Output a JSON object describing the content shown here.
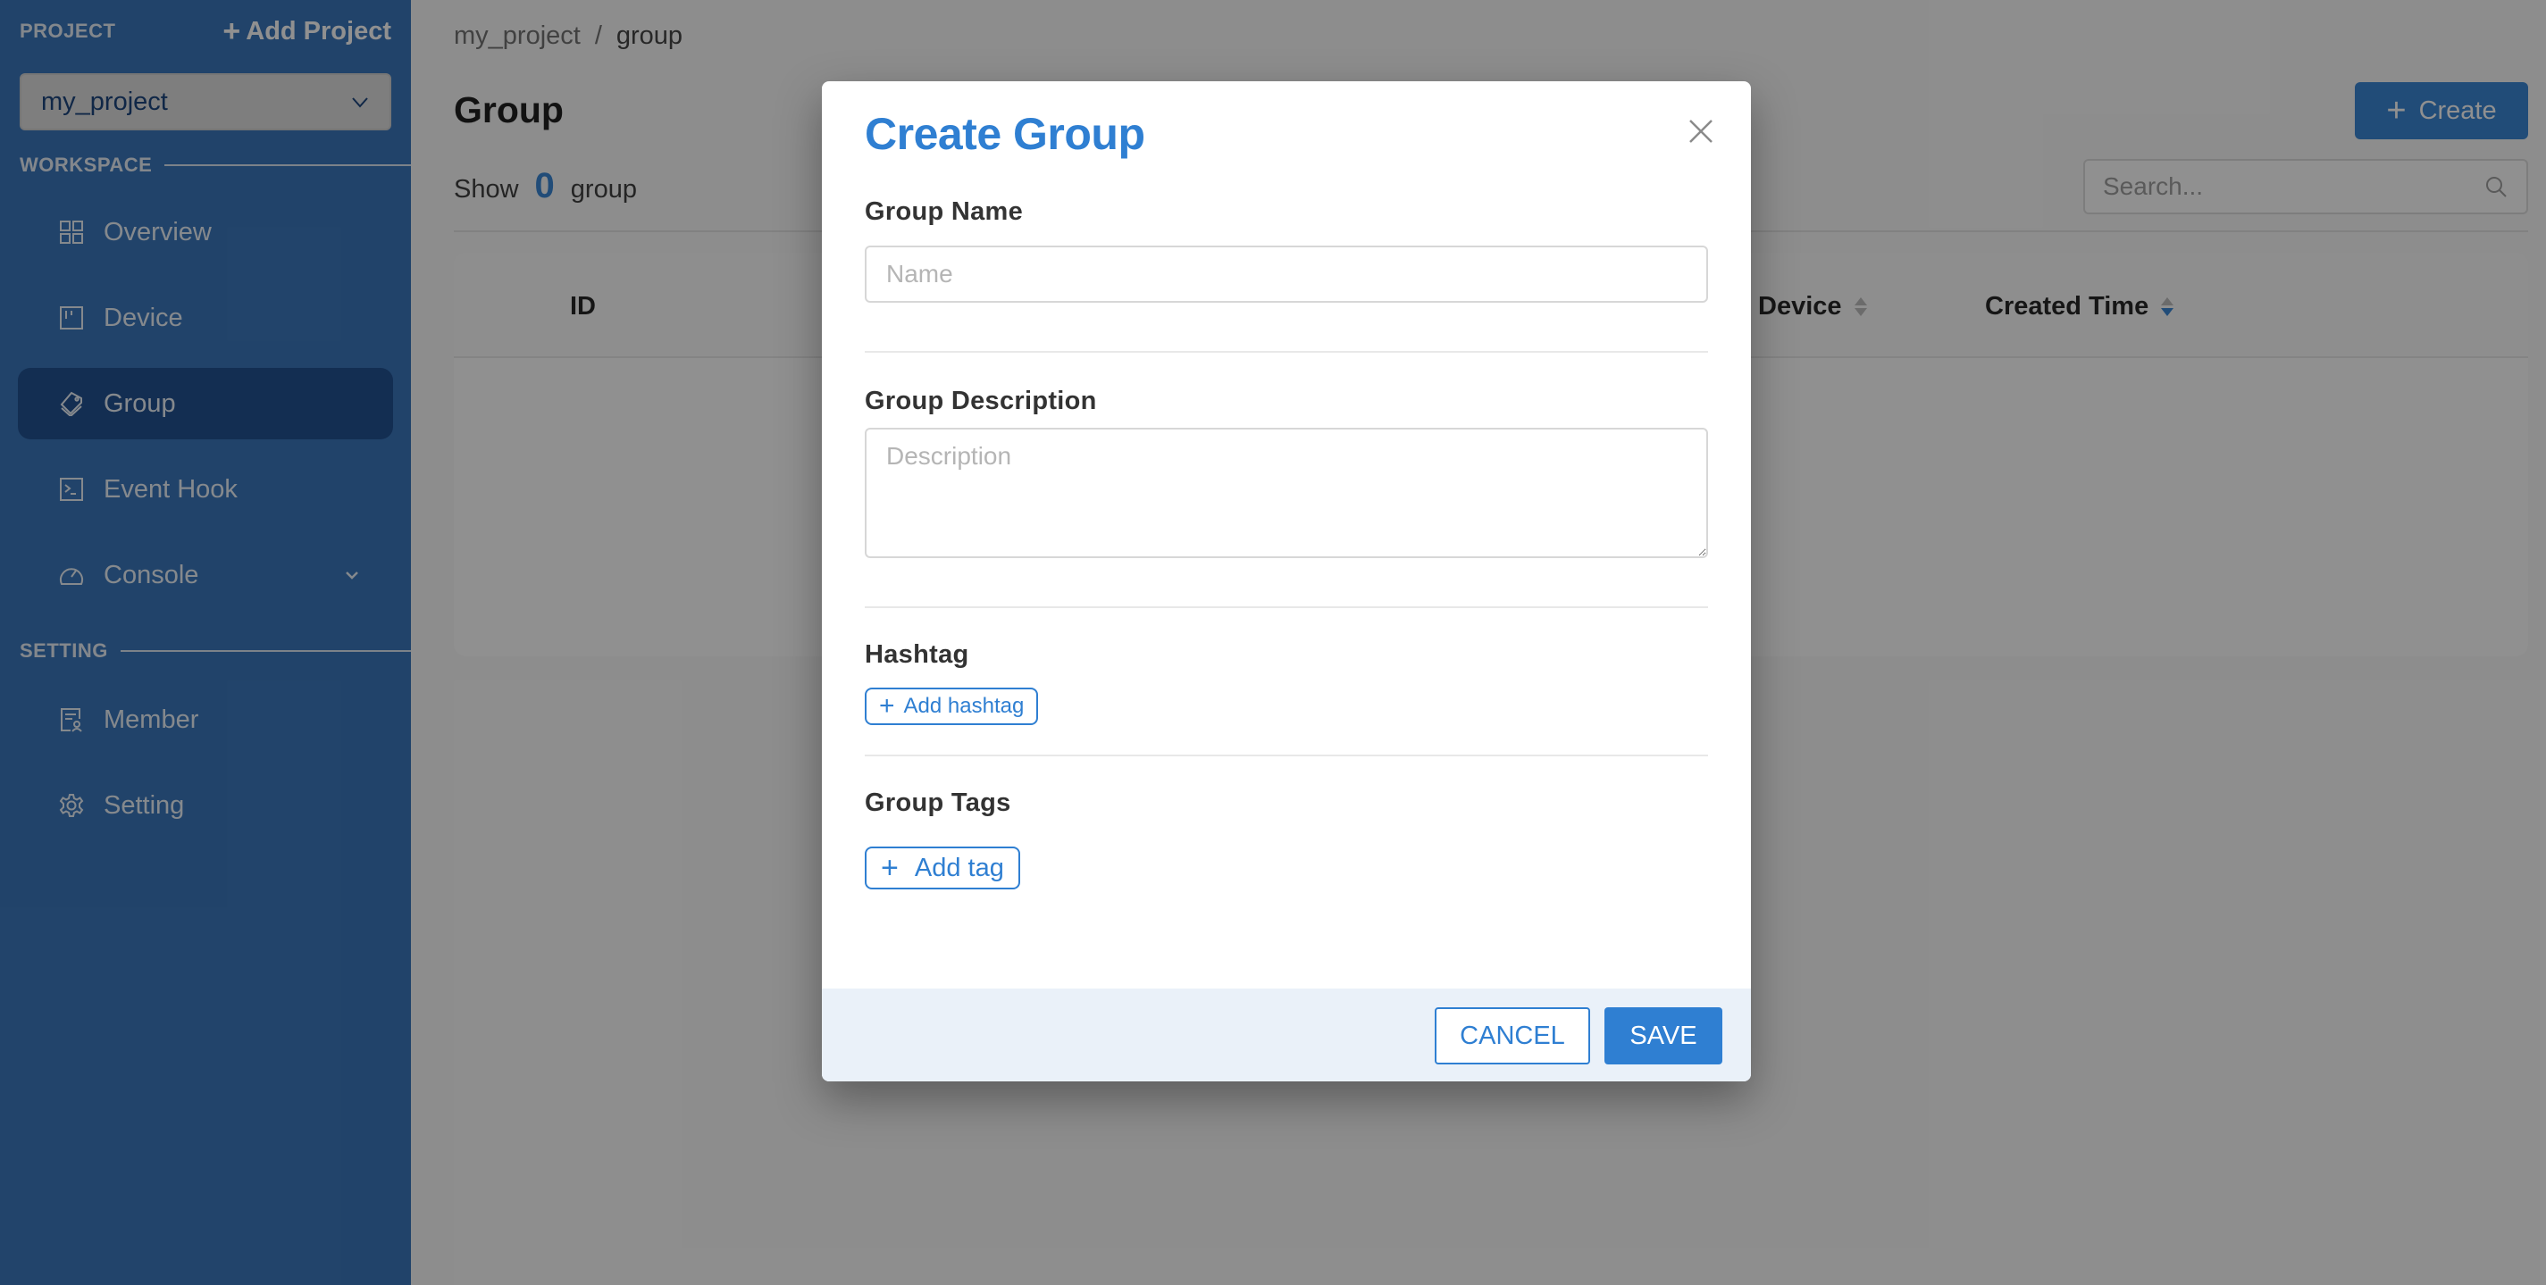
{
  "sidebar": {
    "project_label": "PROJECT",
    "add_project_label": "Add Project",
    "project_select": {
      "value": "my_project"
    },
    "workspace_label": "WORKSPACE",
    "setting_label": "SETTING",
    "workspace_items": [
      {
        "label": "Overview",
        "icon": "grid-icon",
        "active": false
      },
      {
        "label": "Device",
        "icon": "device-board-icon",
        "active": false
      },
      {
        "label": "Group",
        "icon": "tag-icon",
        "active": true
      },
      {
        "label": "Event Hook",
        "icon": "terminal-icon",
        "active": false
      },
      {
        "label": "Console",
        "icon": "dashboard-gauge-icon",
        "active": false,
        "expandable": true
      }
    ],
    "setting_items": [
      {
        "label": "Member",
        "icon": "member-document-icon"
      },
      {
        "label": "Setting",
        "icon": "gear-icon"
      }
    ]
  },
  "main": {
    "breadcrumb": [
      "my_project",
      "group"
    ],
    "breadcrumb_separator": "/",
    "title": "Group",
    "summary": {
      "prefix": "Show",
      "count": "0",
      "suffix": "group"
    },
    "create_button_label": "Create",
    "search": {
      "placeholder": "Search...",
      "value": ""
    },
    "table": {
      "columns": [
        {
          "label": "ID",
          "sortable": false
        },
        {
          "label": "Device",
          "sortable": true,
          "sort": "none"
        },
        {
          "label": "Created Time",
          "sortable": true,
          "sort": "descending"
        }
      ],
      "rows": []
    }
  },
  "modal": {
    "title": "Create Group",
    "fields": {
      "name": {
        "label": "Group Name",
        "placeholder": "Name",
        "value": ""
      },
      "description": {
        "label": "Group Description",
        "placeholder": "Description",
        "value": ""
      },
      "hashtag": {
        "label": "Hashtag",
        "button_label": "Add hashtag"
      },
      "tags": {
        "label": "Group Tags",
        "button_label": "Add tag"
      }
    },
    "cancel_label": "CANCEL",
    "save_label": "SAVE"
  },
  "colors": {
    "accent": "#2f7fd2",
    "sidebar": "#2f6fb8",
    "sidebar_active": "#14468a",
    "modal_footer": "#eaf1f9",
    "overlay": "rgba(20,20,20,0.47)"
  }
}
